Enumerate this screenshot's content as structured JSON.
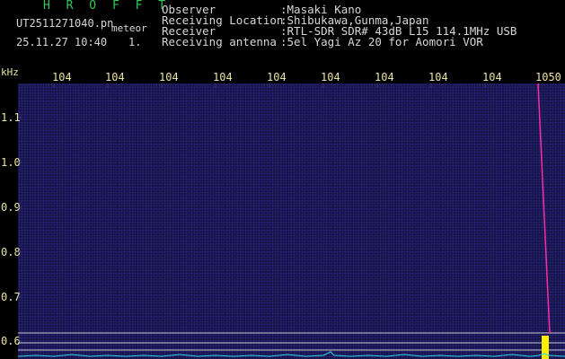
{
  "header": {
    "title": "H R O F F T",
    "filename": "UT2511271040.pn",
    "meteor_label": "meteor",
    "datetime": "25.11.27 10:40",
    "count": "1."
  },
  "info": [
    {
      "key": "Observer",
      "value": ":Masaki Kano"
    },
    {
      "key": "Receiving Location",
      "value": ":Shibukawa,Gunma,Japan"
    },
    {
      "key": "Receiver",
      "value": ":RTL-SDR SDR# 43dB L15 114.1MHz USB"
    },
    {
      "key": "Receiving antenna",
      "value": ":5el Yagi Az 20 for Aomori VOR"
    }
  ],
  "axis": {
    "unit": "kHz",
    "x_ticks": [
      "104",
      "104",
      "104",
      "104",
      "104",
      "104",
      "104",
      "104",
      "104",
      "1050"
    ],
    "y_ticks": [
      "1.1",
      "1.0",
      "0.9",
      "0.8",
      "0.7",
      "0.6"
    ]
  },
  "colors": {
    "background": "#000000",
    "plot_bg": "#161449",
    "axis_text": "#e9e3a0",
    "title_green": "#2fc85a",
    "signal_line": "#ff2aa0",
    "spectrum": "#2ad8e8",
    "marker": "#ffee00"
  }
}
